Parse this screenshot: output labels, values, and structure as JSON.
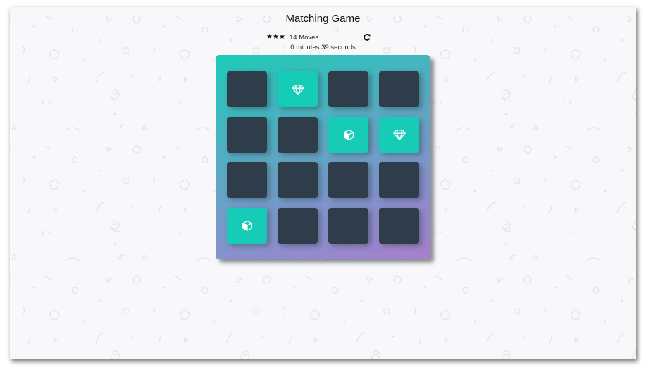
{
  "header": {
    "title": "Matching Game"
  },
  "score_panel": {
    "stars": [
      {
        "icon": "star-icon",
        "glyph": "★",
        "filled": true
      },
      {
        "icon": "star-icon",
        "glyph": "★",
        "filled": true
      },
      {
        "icon": "star-icon",
        "glyph": "★",
        "filled": true
      }
    ],
    "moves_label": "14 Moves",
    "moves": 14,
    "restart_icon": "repeat-icon"
  },
  "timer": {
    "text": "0 minutes 39 seconds"
  },
  "colors": {
    "card_closed": "#2e3d49",
    "card_matched": "#17ccb6",
    "deck_gradient_start": "#1ccab8",
    "deck_gradient_end": "#aa7ecd",
    "background": "#f8f8fa"
  },
  "deck": {
    "rows": 4,
    "cols": 4,
    "cards": [
      {
        "state": "closed",
        "icon": ""
      },
      {
        "state": "match",
        "icon": "diamond-icon"
      },
      {
        "state": "closed",
        "icon": ""
      },
      {
        "state": "closed",
        "icon": ""
      },
      {
        "state": "closed",
        "icon": ""
      },
      {
        "state": "closed",
        "icon": ""
      },
      {
        "state": "match",
        "icon": "cube-icon"
      },
      {
        "state": "match",
        "icon": "diamond-icon"
      },
      {
        "state": "closed",
        "icon": ""
      },
      {
        "state": "closed",
        "icon": ""
      },
      {
        "state": "closed",
        "icon": ""
      },
      {
        "state": "closed",
        "icon": ""
      },
      {
        "state": "match",
        "icon": "cube-icon"
      },
      {
        "state": "closed",
        "icon": ""
      },
      {
        "state": "closed",
        "icon": ""
      },
      {
        "state": "closed",
        "icon": ""
      }
    ]
  }
}
